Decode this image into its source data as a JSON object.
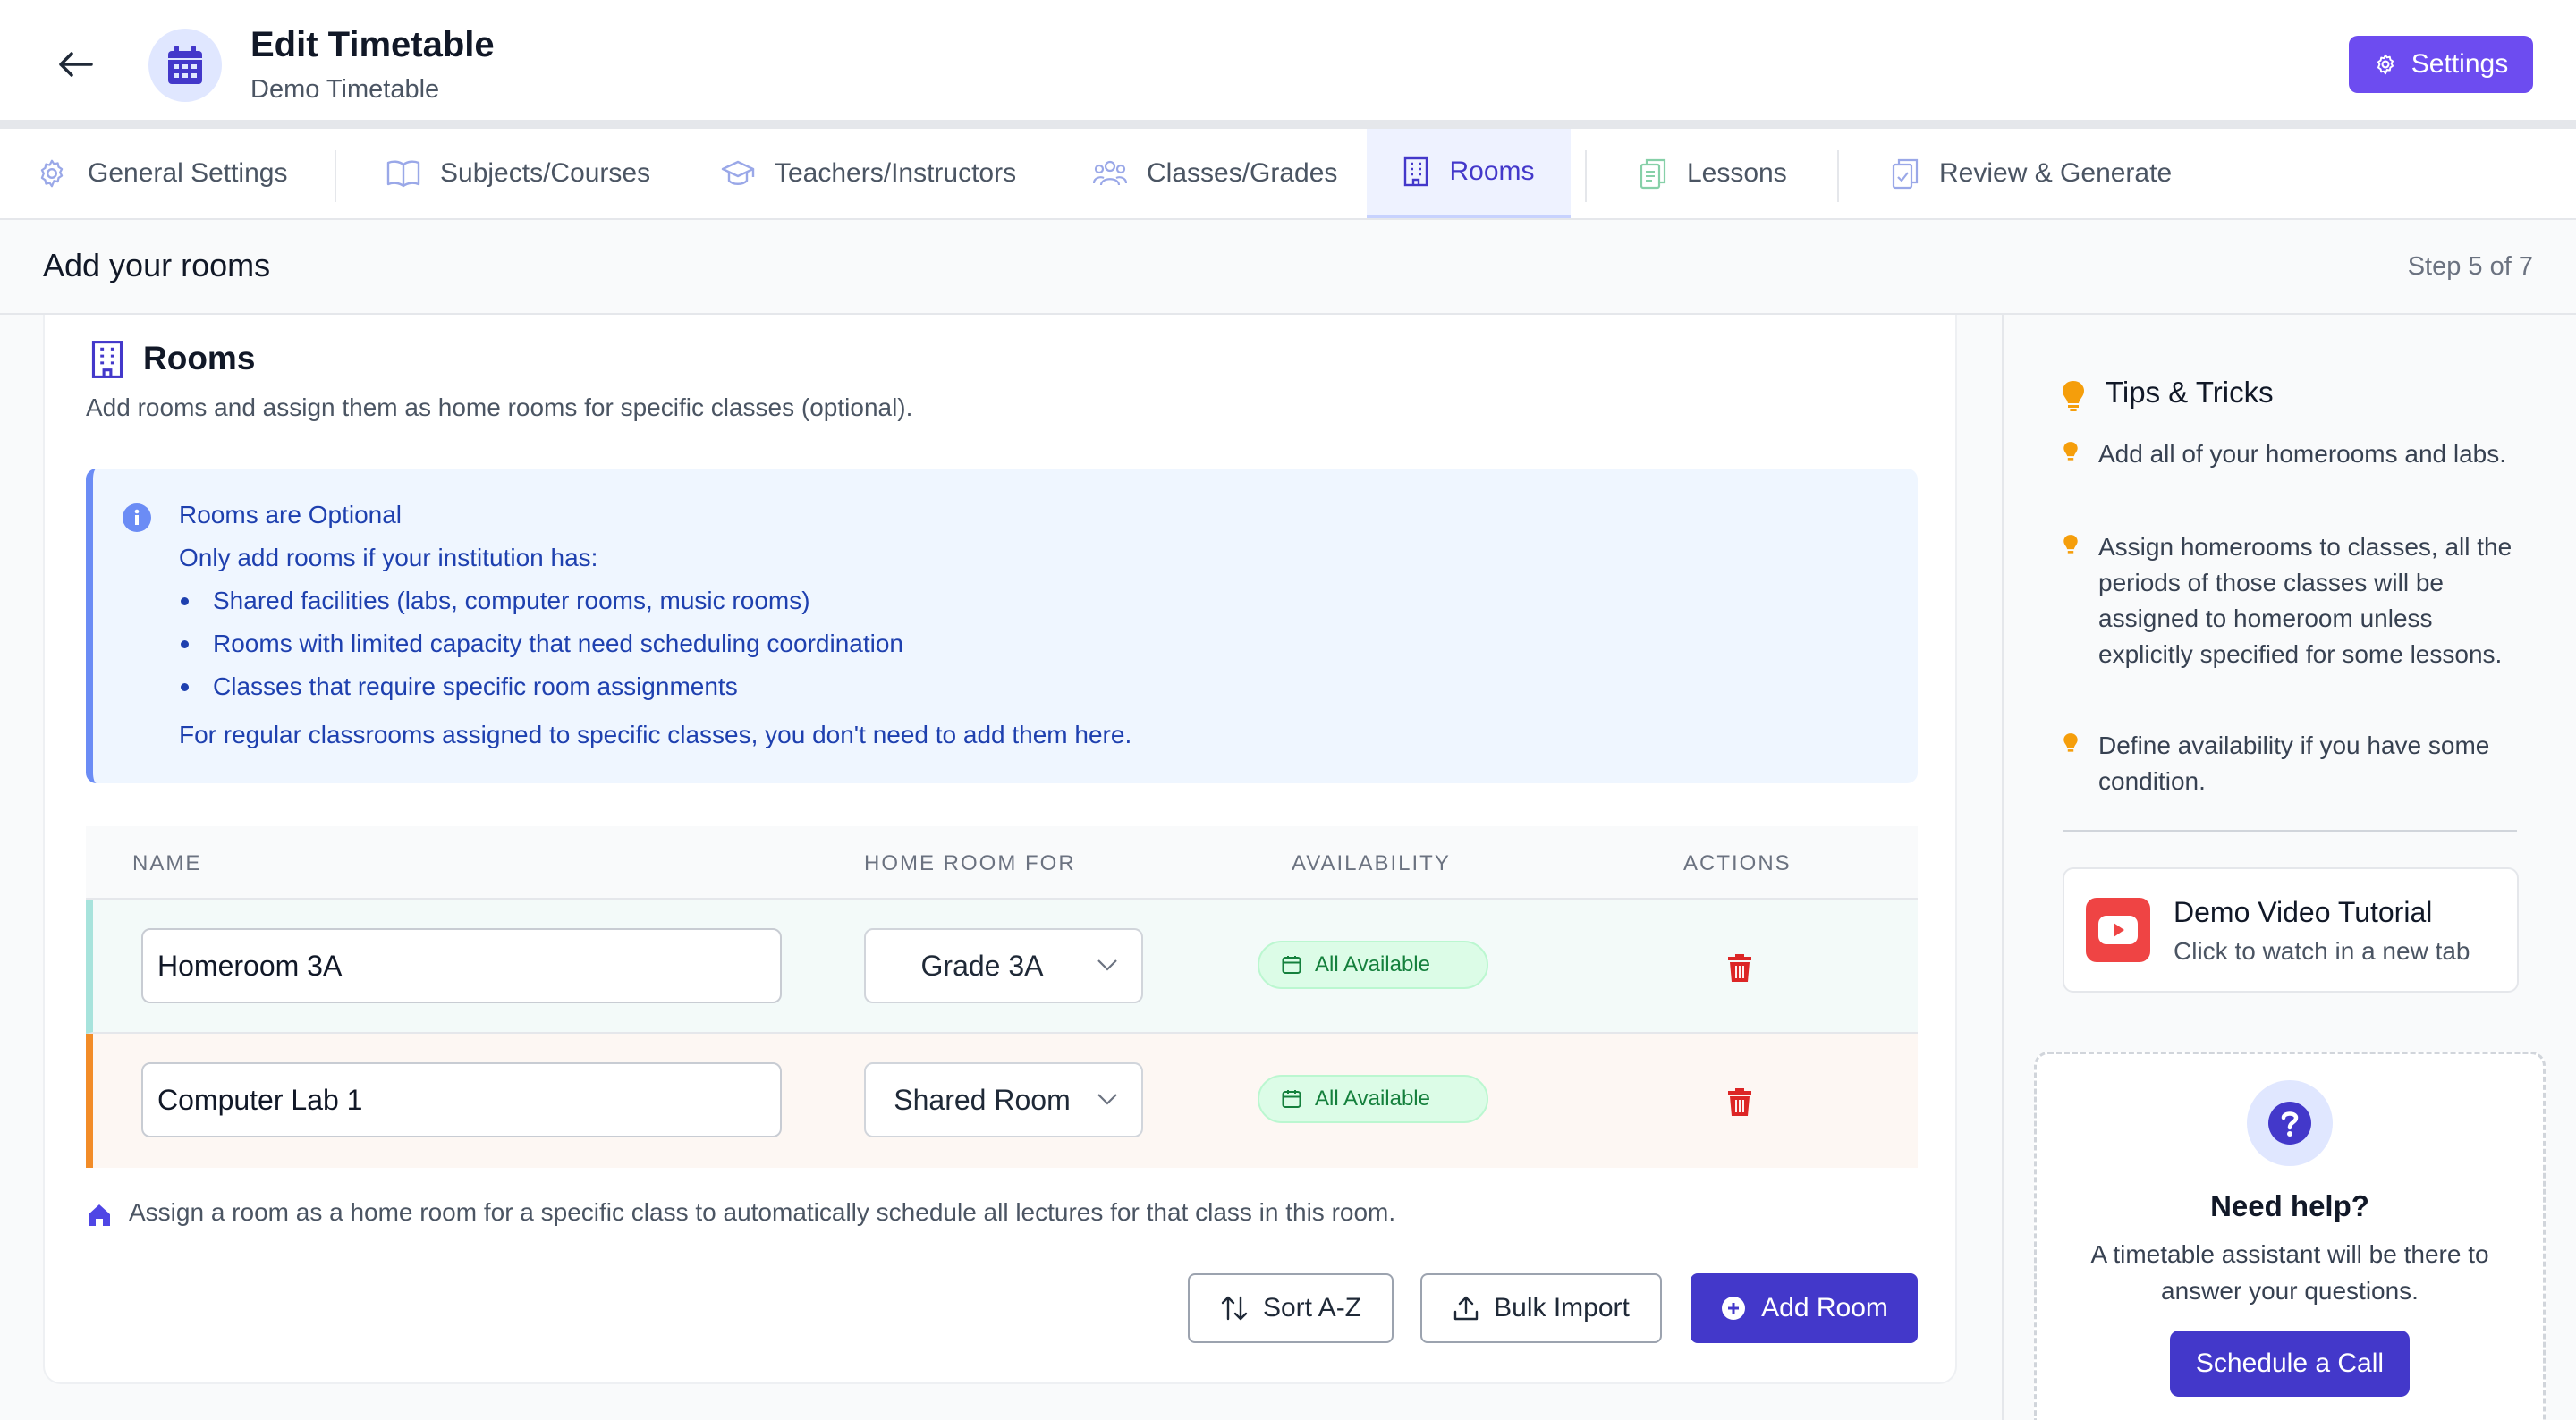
{
  "header": {
    "title": "Edit Timetable",
    "subtitle": "Demo Timetable",
    "settings_label": "Settings"
  },
  "tabs": [
    {
      "label": "General Settings",
      "icon": "gear-icon"
    },
    {
      "label": "Subjects/Courses",
      "icon": "book-icon"
    },
    {
      "label": "Teachers/Instructors",
      "icon": "graduation-cap-icon"
    },
    {
      "label": "Classes/Grades",
      "icon": "users-icon"
    },
    {
      "label": "Rooms",
      "icon": "building-icon",
      "active": true
    },
    {
      "label": "Lessons",
      "icon": "documents-icon"
    },
    {
      "label": "Review & Generate",
      "icon": "clipboard-check-icon"
    }
  ],
  "step": {
    "title": "Add your rooms",
    "counter": "Step 5 of 7"
  },
  "section": {
    "title": "Rooms",
    "description": "Add rooms and assign them as home rooms for specific classes (optional)."
  },
  "info": {
    "title": "Rooms are Optional",
    "intro": "Only add rooms if your institution has:",
    "items": [
      "Shared facilities (labs, computer rooms, music rooms)",
      "Rooms with limited capacity that need scheduling coordination",
      "Classes that require specific room assignments"
    ],
    "footer": "For regular classrooms assigned to specific classes, you don't need to add them here."
  },
  "table": {
    "headers": {
      "name": "NAME",
      "home_room_for": "HOME ROOM FOR",
      "availability": "AVAILABILITY",
      "actions": "ACTIONS"
    },
    "rows": [
      {
        "name": "Homeroom 3A",
        "home_room_for": "Grade 3A",
        "availability": "All Available",
        "accent": "#a7e3dc"
      },
      {
        "name": "Computer Lab 1",
        "home_room_for": "Shared Room",
        "availability": "All Available",
        "accent": "#f28c28"
      }
    ]
  },
  "note": "Assign a room as a home room for a specific class to automatically schedule all lectures for that class in this room.",
  "buttons": {
    "sort": "Sort A-Z",
    "bulk_import": "Bulk Import",
    "add_room": "Add Room"
  },
  "tips": {
    "title": "Tips & Tricks",
    "items": [
      "Add all of your homerooms and labs.",
      "Assign homerooms to classes, all the periods of those classes will be assigned to homeroom unless explicitly specified for some lessons.",
      "Define availability if you have some condition."
    ]
  },
  "video": {
    "title": "Demo Video Tutorial",
    "subtitle": "Click to watch in a new tab"
  },
  "help": {
    "title": "Need help?",
    "text": "A timetable assistant will be there to answer your questions.",
    "button": "Schedule a Call"
  },
  "colors": {
    "accent": "#4338ca",
    "settings_button": "#6d4cf0",
    "available_badge": "#dcfce7",
    "delete": "#dc2626",
    "tip_bulb": "#f59e0b"
  }
}
